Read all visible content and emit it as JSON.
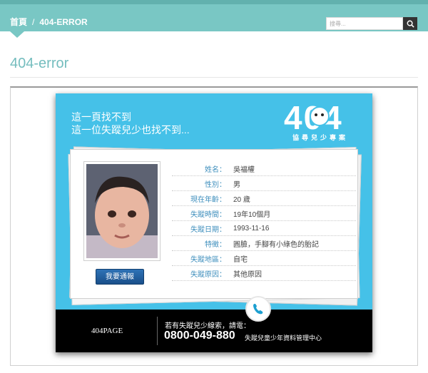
{
  "header": {
    "breadcrumb_home": "首頁",
    "breadcrumb_sep": "/",
    "breadcrumb_current": "404-ERROR",
    "search_placeholder": "搜尋..."
  },
  "page": {
    "title": "404-error"
  },
  "poster": {
    "headline_line1": "這一頁找不到",
    "headline_line2": "這一位失蹤兒少也找不到...",
    "logo_text": "404",
    "logo_sub": "協尋兒少專案",
    "report_button": "我要通報",
    "fields": [
      {
        "label": "姓名：",
        "value": "吳福權"
      },
      {
        "label": "性別：",
        "value": "男"
      },
      {
        "label": "現在年齡：",
        "value": "20 歲"
      },
      {
        "label": "失蹤時間：",
        "value": "19年10個月"
      },
      {
        "label": "失蹤日期：",
        "value": "1993-11-16"
      },
      {
        "label": "特徵：",
        "value": "圓臉，手腳有小綠色的胎記"
      },
      {
        "label": "失蹤地區：",
        "value": "自宅"
      },
      {
        "label": "失蹤原因：",
        "value": "其他原因"
      }
    ],
    "footer_brand": "404PAGE",
    "footer_prompt": "若有失蹤兒少線索，請電：",
    "footer_phone": "0800-049-880",
    "footer_org": "失蹤兒童少年資料管理中心"
  },
  "colors": {
    "topbar": "#79c7c4",
    "accent": "#74bdbe",
    "poster_bg": "#45c1e8",
    "button": "#2e72b6"
  },
  "icons": {
    "search": "search-icon",
    "phone": "phone-icon"
  }
}
